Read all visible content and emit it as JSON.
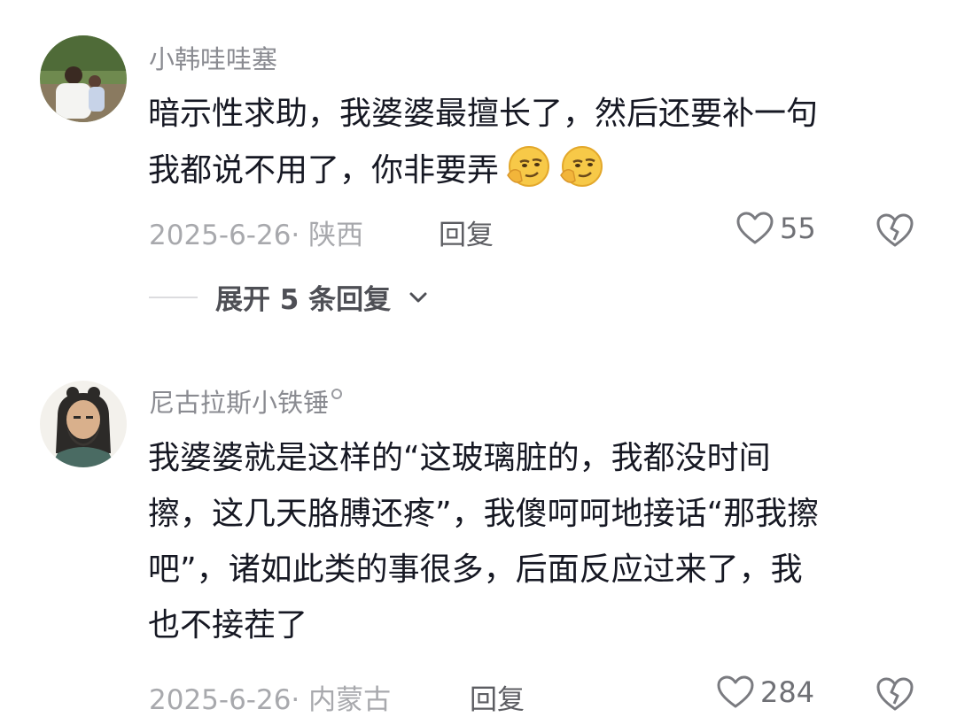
{
  "comments": [
    {
      "username": "小韩哇哇塞",
      "lines": [
        "暗示性求助，我婆婆最擅长了，然后还要补一句",
        "我都说不用了，你非要弄"
      ],
      "emoji": [
        "thinking-smirk-emoji",
        "thinking-smirk-emoji"
      ],
      "meta": "2025-6-26· 陕西",
      "reply_label": "回复",
      "like_count": "55",
      "expand_label": "展开 5 条回复"
    },
    {
      "username": "尼古拉斯小铁锤",
      "lines": [
        "我婆婆就是这样的“这玻璃脏的，我都没时间",
        "擦，这几天胳膊还疼”，我傻呵呵地接话“那我擦",
        "吧”，诸如此类的事很多，后面反应过来了，我",
        "也不接茬了"
      ],
      "meta": "2025-6-26· 内蒙古",
      "reply_label": "回复",
      "like_count": "284"
    }
  ],
  "icons": {
    "like": "heart-outline-icon",
    "dislike": "broken-heart-icon",
    "expand": "chevron-down-icon"
  },
  "colors": {
    "text": "#161823",
    "username": "#8a8b91",
    "meta": "#a8a9ad"
  }
}
